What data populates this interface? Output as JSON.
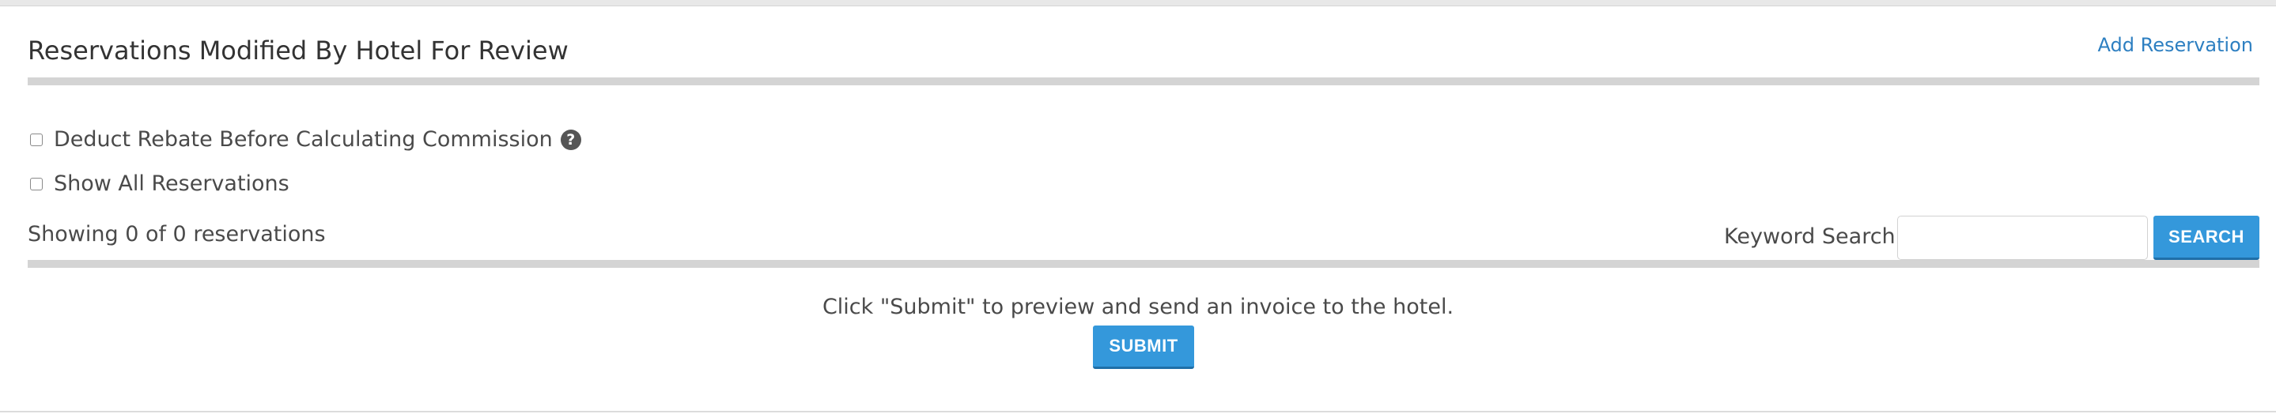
{
  "panel": {
    "title": "Reservations Modified By Hotel For Review",
    "add_link": "Add Reservation"
  },
  "options": {
    "rebate_label": "Deduct Rebate Before Calculating Commission",
    "rebate_checked": false,
    "help_icon": "question-circle-icon",
    "show_all_label": "Show All Reservations",
    "show_all_checked": false
  },
  "list": {
    "showing_text": "Showing 0 of 0 reservations"
  },
  "search": {
    "label": "Keyword Search:",
    "value": "",
    "placeholder": "",
    "button_label": "SEARCH"
  },
  "footer": {
    "instruction": "Click \"Submit\" to preview and send an invoice to the hotel.",
    "submit_label": "SUBMIT"
  },
  "colors": {
    "accent": "#3498db",
    "link": "#2d7fc1",
    "divider": "#d4d4d4",
    "text": "#4a4a4a"
  }
}
